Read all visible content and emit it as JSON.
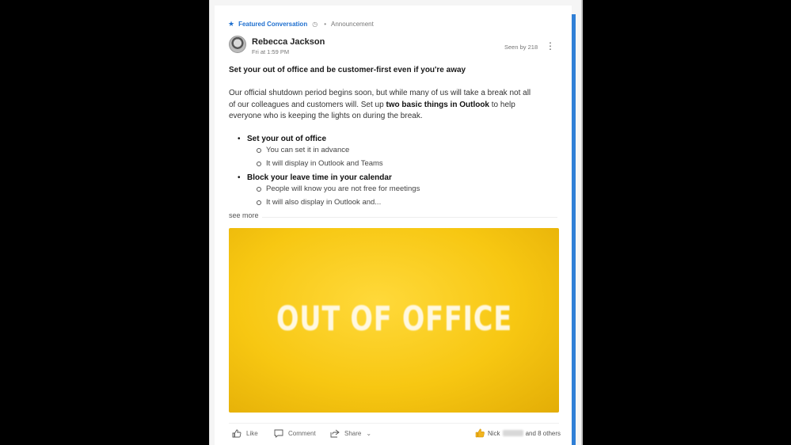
{
  "post": {
    "featured_label": "Featured Conversation",
    "type_label": "Announcement",
    "author": "Rebecca Jackson",
    "time": "Fri at 1:59 PM",
    "seen_by": "Seen by 218",
    "title": "Set your out of office and be customer-first even if you're away",
    "para_line1": "Our official shutdown period begins soon, but while many of us will take a break not all",
    "para_line2_pre": "of our colleagues and customers will. Set up ",
    "para_line2_bold": "two basic things in Outlook",
    "para_line2_post": " to help",
    "para_line3": "everyone who is keeping the lights on during the break.",
    "list": [
      {
        "label": "Set your out of office",
        "sub": [
          "You can set it in advance",
          "It will display in Outlook and Teams"
        ]
      },
      {
        "label": "Block your leave time in your calendar",
        "sub": [
          "People will know you are not free for meetings",
          "It will also display in Outlook and..."
        ]
      }
    ],
    "see_more": "see more",
    "image_text": "OUT OF OFFICE"
  },
  "actions": {
    "like": "Like",
    "comment": "Comment",
    "share": "Share"
  },
  "reactions": {
    "name": "Nick",
    "others": "and 8 others"
  },
  "colors": {
    "accent": "#1e6fcf",
    "image_yellow": "#f7c712"
  },
  "icons": {
    "featured": "star-icon",
    "seen": "clock-icon",
    "more": "more-options-icon",
    "like": "thumbs-up-icon",
    "comment": "comment-icon",
    "share": "share-icon",
    "reaction": "like-reaction-icon"
  }
}
